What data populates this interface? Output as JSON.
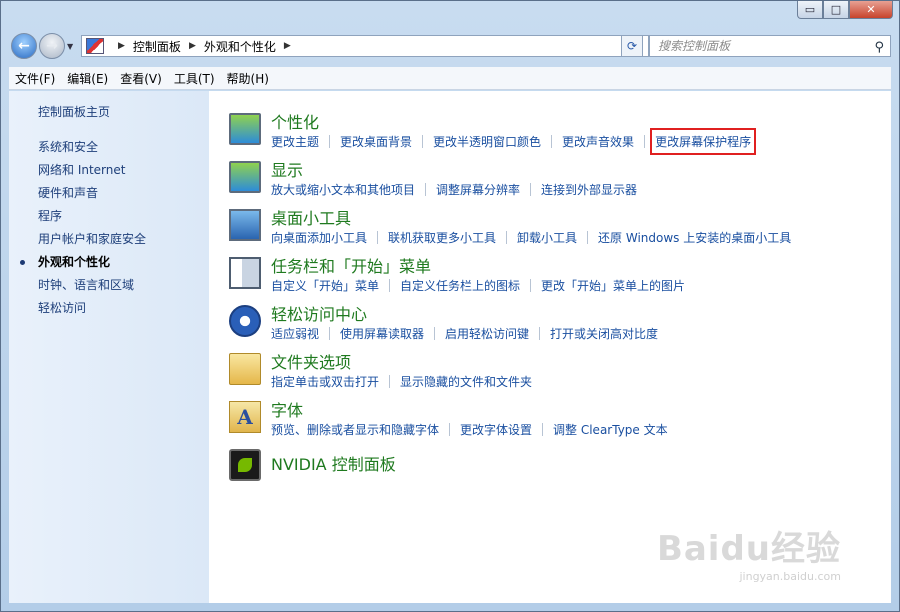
{
  "window": {
    "minimize": "▭",
    "maximize": "□",
    "close": "✕"
  },
  "address": {
    "crumbs": [
      "控制面板",
      "外观和个性化"
    ]
  },
  "search": {
    "placeholder": "搜索控制面板"
  },
  "menu": [
    "文件(F)",
    "编辑(E)",
    "查看(V)",
    "工具(T)",
    "帮助(H)"
  ],
  "sidebar": {
    "home": "控制面板主页",
    "items": [
      {
        "label": "系统和安全"
      },
      {
        "label": "网络和 Internet"
      },
      {
        "label": "硬件和声音"
      },
      {
        "label": "程序"
      },
      {
        "label": "用户帐户和家庭安全"
      },
      {
        "label": "外观和个性化",
        "active": true
      },
      {
        "label": "时钟、语言和区域"
      },
      {
        "label": "轻松访问"
      }
    ]
  },
  "categories": [
    {
      "title": "个性化",
      "icon": "personalization-icon",
      "links": [
        "更改主题",
        "更改桌面背景",
        "更改半透明窗口颜色",
        "更改声音效果",
        "更改屏幕保护程序"
      ],
      "highlight": 4
    },
    {
      "title": "显示",
      "icon": "display-icon",
      "links": [
        "放大或缩小文本和其他项目",
        "调整屏幕分辨率",
        "连接到外部显示器"
      ]
    },
    {
      "title": "桌面小工具",
      "icon": "gadgets-icon",
      "links": [
        "向桌面添加小工具",
        "联机获取更多小工具",
        "卸载小工具",
        "还原 Windows 上安装的桌面小工具"
      ]
    },
    {
      "title": "任务栏和「开始」菜单",
      "icon": "taskbar-icon",
      "links": [
        "自定义「开始」菜单",
        "自定义任务栏上的图标",
        "更改「开始」菜单上的图片"
      ]
    },
    {
      "title": "轻松访问中心",
      "icon": "ease-of-access-icon",
      "links": [
        "适应弱视",
        "使用屏幕读取器",
        "启用轻松访问键",
        "打开或关闭高对比度"
      ]
    },
    {
      "title": "文件夹选项",
      "icon": "folder-options-icon",
      "links": [
        "指定单击或双击打开",
        "显示隐藏的文件和文件夹"
      ]
    },
    {
      "title": "字体",
      "icon": "fonts-icon",
      "links": [
        "预览、删除或者显示和隐藏字体",
        "更改字体设置",
        "调整 ClearType 文本"
      ]
    },
    {
      "title": "NVIDIA 控制面板",
      "icon": "nvidia-icon",
      "links": []
    }
  ],
  "watermark": {
    "brand": "Baidu经验",
    "url": "jingyan.baidu.com"
  }
}
